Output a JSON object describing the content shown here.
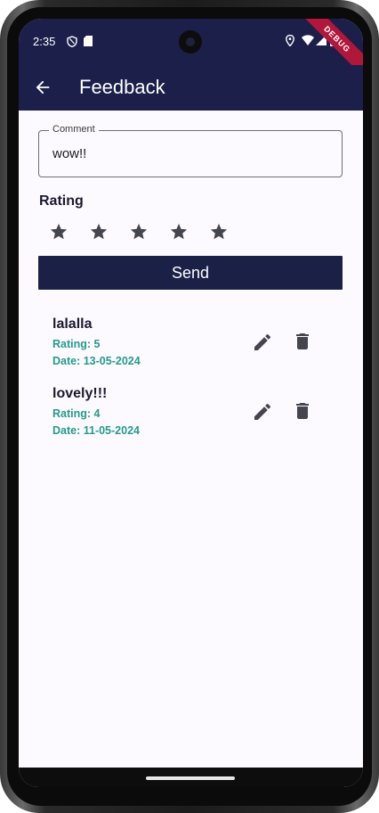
{
  "status_bar": {
    "time": "2:35",
    "debug_banner": "DEBUG"
  },
  "app_bar": {
    "title": "Feedback"
  },
  "comment_field": {
    "label": "Comment",
    "value": "wow!!"
  },
  "rating": {
    "label": "Rating",
    "max_stars": 5
  },
  "send_button": {
    "label": "Send"
  },
  "feedback_items": [
    {
      "comment": "lalalla",
      "rating": "Rating: 5",
      "date": "Date: 13-05-2024"
    },
    {
      "comment": "lovely!!!",
      "rating": "Rating: 4",
      "date": "Date: 11-05-2024"
    }
  ],
  "colors": {
    "primary": "#1b1f4a",
    "accent_text": "#269b8c",
    "background": "#fcf9ff"
  },
  "icons": [
    "arrow-back-icon",
    "star-icon",
    "edit-icon",
    "delete-icon",
    "location-icon",
    "wifi-icon",
    "signal-icon",
    "battery-icon"
  ]
}
